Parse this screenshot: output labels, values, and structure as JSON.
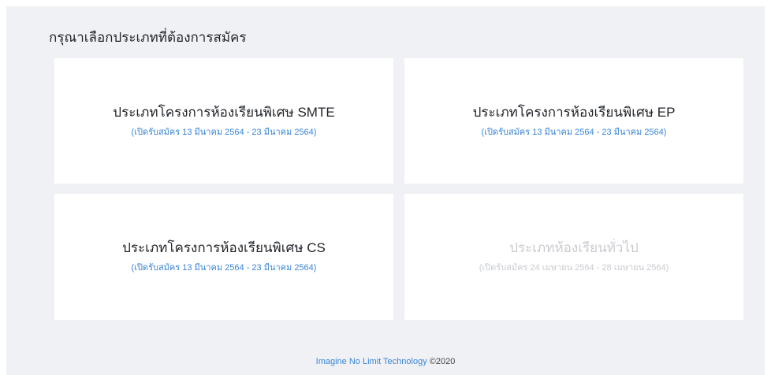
{
  "heading": "กรุณาเลือกประเภทที่ต้องการสมัคร",
  "cards": [
    {
      "title": "ประเภทโครงการห้องเรียนพิเศษ SMTE",
      "period": "(เปิดรับสมัคร 13 มีนาคม 2564 - 23 มีนาคม 2564)",
      "enabled": true
    },
    {
      "title": "ประเภทโครงการห้องเรียนพิเศษ EP",
      "period": "(เปิดรับสมัคร 13 มีนาคม 2564 - 23 มีนาคม 2564)",
      "enabled": true
    },
    {
      "title": "ประเภทโครงการห้องเรียนพิเศษ CS",
      "period": "(เปิดรับสมัคร 13 มีนาคม 2564 - 23 มีนาคม 2564)",
      "enabled": true
    },
    {
      "title": "ประเภทห้องเรียนทั่วไป",
      "period": "(เปิดรับสมัคร 24 เมษายน 2564 - 28 เมษายน 2564)",
      "enabled": false
    }
  ],
  "footer": {
    "company": "Imagine No Limit Technology",
    "copyright": "©2020"
  },
  "colors": {
    "background": "#f0f1f5",
    "card": "#ffffff",
    "link": "#3a86d6",
    "disabled": "#c9cbd0",
    "text": "#1f2328"
  }
}
